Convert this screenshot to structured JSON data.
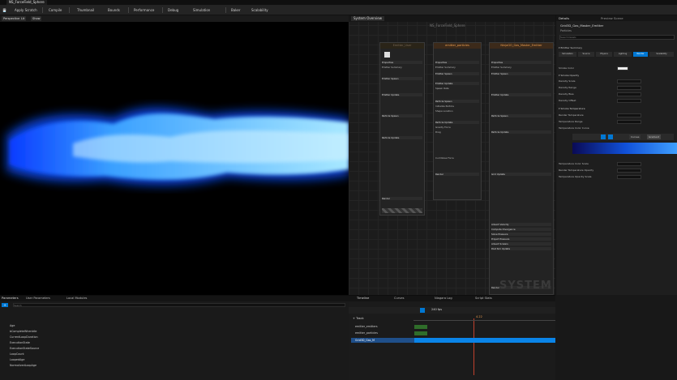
{
  "window": {
    "tab_title": "NS_ForceField_Sphere"
  },
  "toolbar": {
    "items": [
      "Save",
      "Apply Scratch",
      "Compile",
      "Thumbnail",
      "Bounds",
      "Performance",
      "Debug",
      "Simulation",
      "Baker",
      "Scalability"
    ]
  },
  "viewport": {
    "buttons": [
      "Perspective",
      "Lit",
      "Show"
    ]
  },
  "graph": {
    "tab_label": "System Overview",
    "system_title": "NS_ForceField_Sphere",
    "watermark": "SYSTEM",
    "nodes": [
      {
        "title": "Emitter_User",
        "rows": [
          "Properties",
          "Emitter Summary",
          "Emitter Spawn",
          "Emitter Update",
          "Particle Spawn",
          "Particle Update",
          "Render"
        ]
      },
      {
        "title": "emitter_particles",
        "rows": [
          "Properties",
          "Emitter Summary",
          "Emitter Spawn",
          "Emitter Update",
          "Spawn Rate",
          "Particle Spawn",
          "Initialize Particle",
          "Shape Location",
          "Particle Update",
          "Gravity Force",
          "Drag",
          "Curl Noise Force",
          "Render"
        ]
      },
      {
        "title": "NinjaGO_Gas_Master_Emitter",
        "rows": [
          "Properties",
          "Emitter Summary",
          "Emitter Spawn",
          "Emitter Update",
          "Particle Spawn",
          "Particle Update",
          "Grid Update",
          "Advect Velocity",
          "Compute Divergence",
          "Solve Pressure",
          "Project Pressure",
          "Advect Scalars",
          "Post Sim Update",
          "Render"
        ]
      }
    ]
  },
  "details": {
    "tabs": [
      "Details",
      "Preview Scene"
    ],
    "object_name": "Grid3D_Gas_Master_Emitter",
    "subtitle": "Particles",
    "search_placeholder": "Search Details",
    "filter_tabs": [
      "Simulation",
      "Source",
      "Physics",
      "Lighting",
      "Render",
      "Scalability"
    ],
    "sections": [
      {
        "title": "Emitter Summary",
        "rows": [
          "Smoke Color",
          "Smoke Opacity",
          "Density Scale",
          "Density Range",
          "Density Bias",
          "Density Offset",
          "Smoke Temperature"
        ]
      },
      {
        "title": "Smoke Temperature",
        "rows": [
          "Render Temperature",
          "Temperature Range",
          "Temperature Color Curve",
          "Temperature Color Scale",
          "Render Temperature Opacity",
          "Temperature Opacity Scale"
        ]
      }
    ],
    "curve_buttons": [
      "Curves",
      "Gradient"
    ]
  },
  "params": {
    "tabs": [
      "Parameters",
      "User Parameters",
      "Local Modules"
    ],
    "add_button": "+",
    "search_placeholder": "Search",
    "rows": [
      "Age",
      "bCompleteWhenIdle",
      "CurrentLoopDuration",
      "ExecutionState",
      "ExecutionStateSource",
      "LoopCount",
      "LoopedAge",
      "NormalizedLoopAge"
    ]
  },
  "timeline": {
    "tabs": [
      "Timeline",
      "Curves",
      "Niagara Log",
      "Script Stats"
    ],
    "fps_label": "240 fps",
    "current_time": "4.22",
    "track_header": "Track",
    "tracks": [
      "emitter_emitters",
      "emitter_particles",
      "Grid3D_Gas_M"
    ]
  },
  "colors": {
    "accent": "#0078d4",
    "node_header": "#f0a050",
    "smoke": "#7ecbff"
  }
}
